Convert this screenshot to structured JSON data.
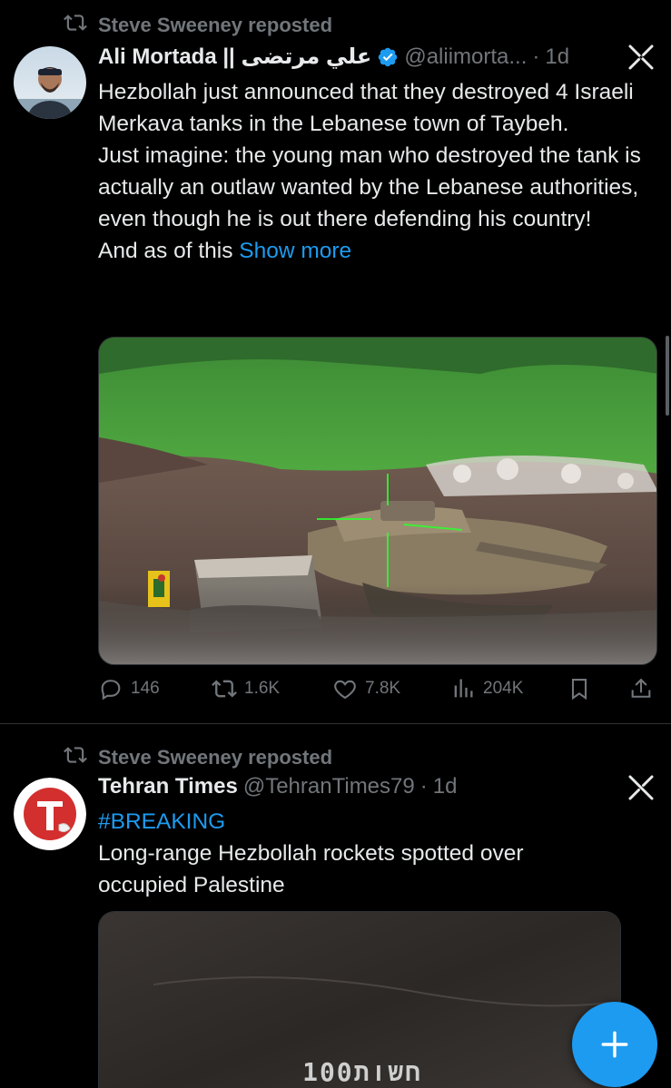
{
  "posts": [
    {
      "repost_label": "Steve Sweeney reposted",
      "display_name": "Ali Mortada || علي مرتضى",
      "handle": "@aliimorta...",
      "separator": "·",
      "time": "1d",
      "lines": [
        "Hezbollah just announced that they destroyed 4 Israeli Merkava tanks in the Lebanese town of Taybeh.",
        "Just imagine: the young man who destroyed the tank is actually an outlaw wanted by the Lebanese authorities, even though he is out there defending his country!",
        "And as of this"
      ],
      "show_more": "Show more",
      "media_icon": "video-thumbnail-tank",
      "stats": {
        "replies": "146",
        "reposts": "1.6K",
        "likes": "7.8K",
        "views": "204K"
      }
    },
    {
      "repost_label": "Steve Sweeney reposted",
      "display_name": "Tehran Times",
      "handle": "@TehranTimes79",
      "separator": "·",
      "time": "1d",
      "hashtag": "#BREAKING",
      "text": "Long-range Hezbollah rockets spotted over occupied Palestine",
      "media_icon": "video-thumbnail-dark",
      "media_caption": "חשות100"
    }
  ],
  "colors": {
    "background": "#000000",
    "text": "#e7e9ea",
    "muted": "#71767b",
    "accent": "#1d9bf0"
  },
  "icons": [
    "repost-icon",
    "verified-icon",
    "grok-icon",
    "reply-icon",
    "like-icon",
    "views-icon",
    "bookmark-icon",
    "share-icon",
    "compose-plus-icon"
  ]
}
